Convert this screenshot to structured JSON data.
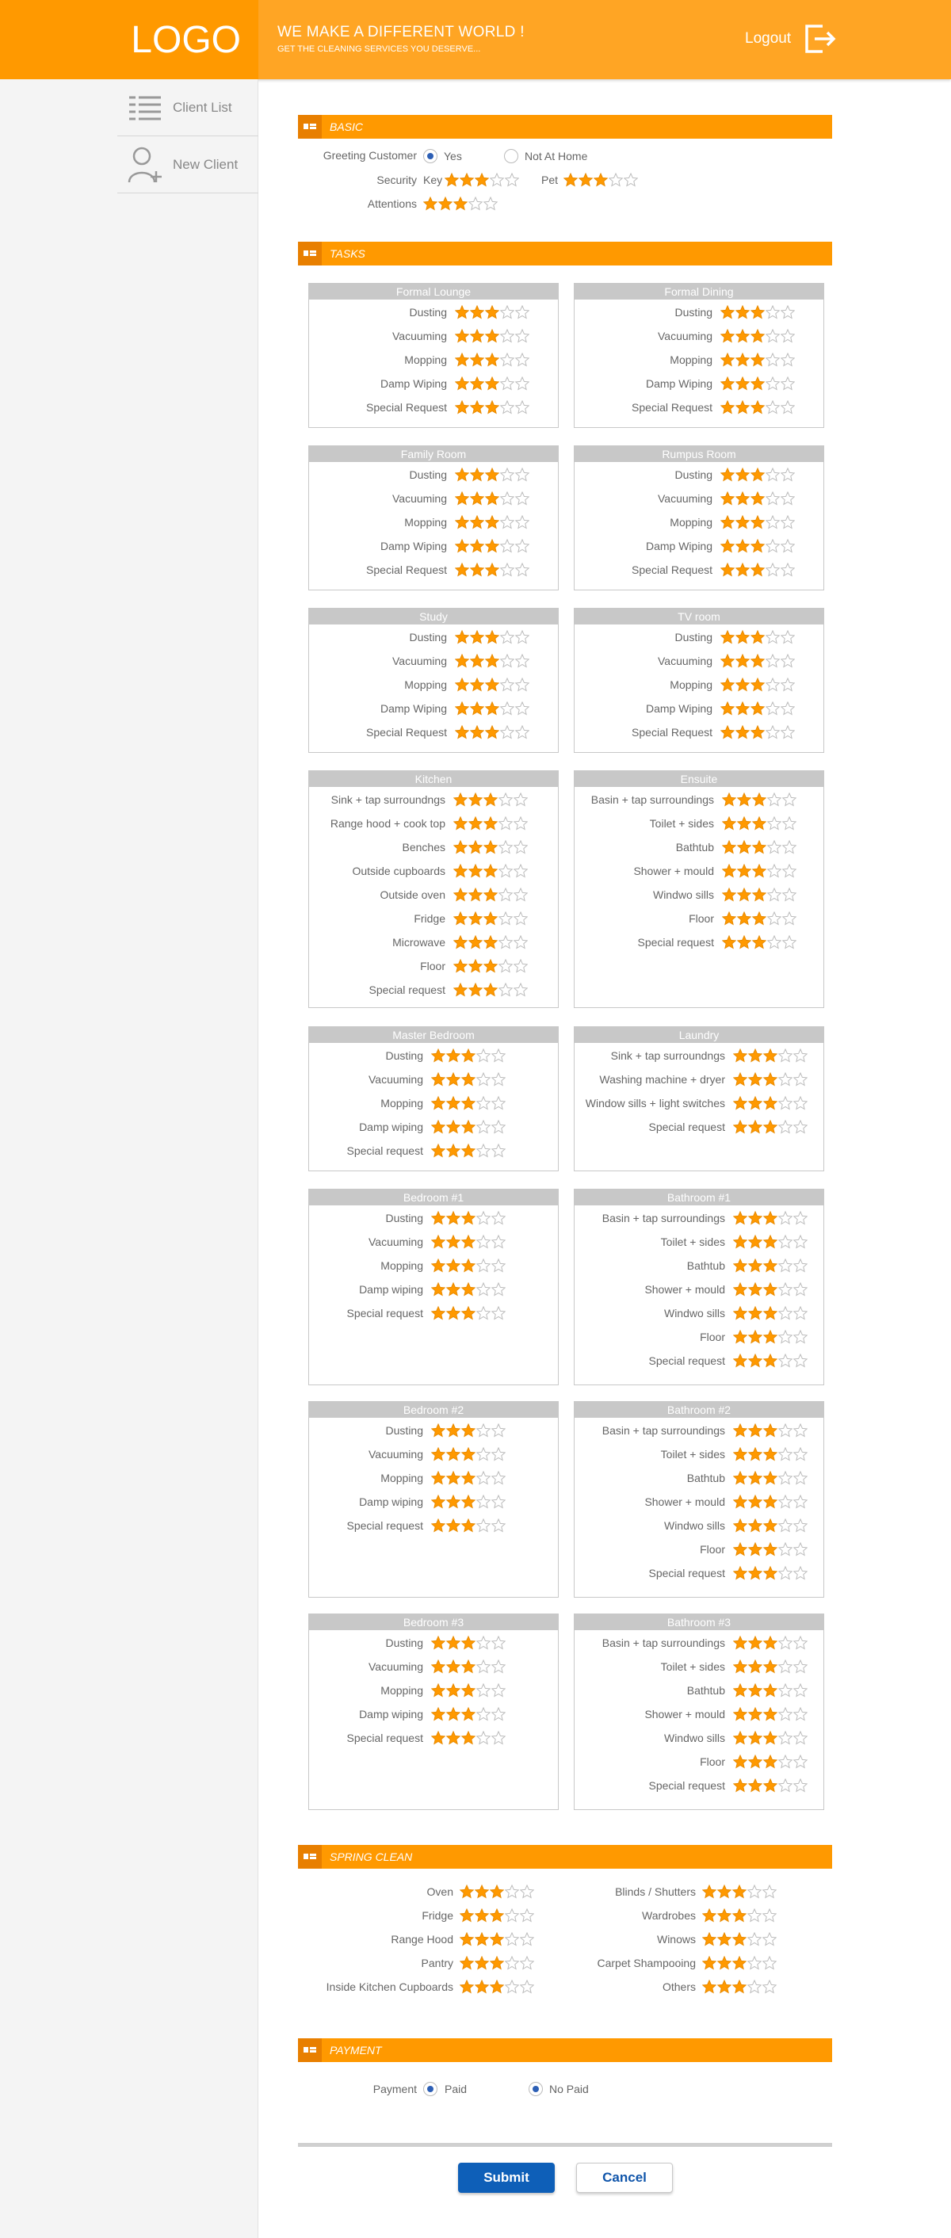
{
  "header": {
    "logo": "LOGO",
    "slogan": "WE MAKE A DIFFERENT WORLD !",
    "tagline": "GET THE CLEANING SERVICES YOU DESERVE...",
    "logout_label": "Logout"
  },
  "sidebar": {
    "items": [
      {
        "label": "Client List",
        "icon": "list-icon"
      },
      {
        "label": "New Client",
        "icon": "add-user-icon"
      }
    ]
  },
  "colors": {
    "accent": "#ff9900",
    "header_bg": "#ffa524",
    "star_filled": "#ff9900",
    "star_empty": "#bbbbbb",
    "room_header": "#c8c8c8",
    "primary_button": "#0e5fb8"
  },
  "basic": {
    "title": "BASIC",
    "greeting_label": "Greeting Customer",
    "greeting_options": [
      "Yes",
      "Not At Home"
    ],
    "greeting_selected": "Yes",
    "security_label": "Security",
    "key_label": "Key",
    "key_rating": 3,
    "pet_label": "Pet",
    "pet_rating": 3,
    "attentions_label": "Attentions",
    "attentions_rating": 3
  },
  "tasks": {
    "title": "TASKS",
    "rooms": [
      {
        "name": "Formal Lounge",
        "items": [
          {
            "label": "Dusting",
            "rating": 3
          },
          {
            "label": "Vacuuming",
            "rating": 3
          },
          {
            "label": "Mopping",
            "rating": 3
          },
          {
            "label": "Damp Wiping",
            "rating": 3
          },
          {
            "label": "Special Request",
            "rating": 3
          }
        ]
      },
      {
        "name": "Formal Dining",
        "items": [
          {
            "label": "Dusting",
            "rating": 3
          },
          {
            "label": "Vacuuming",
            "rating": 3
          },
          {
            "label": "Mopping",
            "rating": 3
          },
          {
            "label": "Damp Wiping",
            "rating": 3
          },
          {
            "label": "Special Request",
            "rating": 3
          }
        ]
      },
      {
        "name": "Family Room",
        "items": [
          {
            "label": "Dusting",
            "rating": 3
          },
          {
            "label": "Vacuuming",
            "rating": 3
          },
          {
            "label": "Mopping",
            "rating": 3
          },
          {
            "label": "Damp Wiping",
            "rating": 3
          },
          {
            "label": "Special Request",
            "rating": 3
          }
        ]
      },
      {
        "name": "Rumpus Room",
        "items": [
          {
            "label": "Dusting",
            "rating": 3
          },
          {
            "label": "Vacuuming",
            "rating": 3
          },
          {
            "label": "Mopping",
            "rating": 3
          },
          {
            "label": "Damp Wiping",
            "rating": 3
          },
          {
            "label": "Special Request",
            "rating": 3
          }
        ]
      },
      {
        "name": "Study",
        "items": [
          {
            "label": "Dusting",
            "rating": 3
          },
          {
            "label": "Vacuuming",
            "rating": 3
          },
          {
            "label": "Mopping",
            "rating": 3
          },
          {
            "label": "Damp Wiping",
            "rating": 3
          },
          {
            "label": "Special Request",
            "rating": 3
          }
        ]
      },
      {
        "name": "TV room",
        "items": [
          {
            "label": "Dusting",
            "rating": 3
          },
          {
            "label": "Vacuuming",
            "rating": 3
          },
          {
            "label": "Mopping",
            "rating": 3
          },
          {
            "label": "Damp Wiping",
            "rating": 3
          },
          {
            "label": "Special Request",
            "rating": 3
          }
        ]
      },
      {
        "name": "Kitchen",
        "items": [
          {
            "label": "Sink + tap surroundngs",
            "rating": 3
          },
          {
            "label": "Range hood + cook top",
            "rating": 3
          },
          {
            "label": "Benches",
            "rating": 3
          },
          {
            "label": "Outside cupboards",
            "rating": 3
          },
          {
            "label": "Outside oven",
            "rating": 3
          },
          {
            "label": "Fridge",
            "rating": 3
          },
          {
            "label": "Microwave",
            "rating": 3
          },
          {
            "label": "Floor",
            "rating": 3
          },
          {
            "label": "Special request",
            "rating": 3
          }
        ]
      },
      {
        "name": "Ensuite",
        "items": [
          {
            "label": "Basin + tap surroundings",
            "rating": 3
          },
          {
            "label": "Toilet + sides",
            "rating": 3
          },
          {
            "label": "Bathtub",
            "rating": 3
          },
          {
            "label": "Shower + mould",
            "rating": 3
          },
          {
            "label": "Windwo sills",
            "rating": 3
          },
          {
            "label": "Floor",
            "rating": 3
          },
          {
            "label": "Special request",
            "rating": 3
          }
        ]
      },
      {
        "name": "Master Bedroom",
        "items": [
          {
            "label": "Dusting",
            "rating": 3
          },
          {
            "label": "Vacuuming",
            "rating": 3
          },
          {
            "label": "Mopping",
            "rating": 3
          },
          {
            "label": "Damp wiping",
            "rating": 3
          },
          {
            "label": "Special request",
            "rating": 3
          }
        ]
      },
      {
        "name": "Laundry",
        "items": [
          {
            "label": "Sink + tap surroundngs",
            "rating": 3
          },
          {
            "label": "Washing machine + dryer",
            "rating": 3
          },
          {
            "label": "Window sills + light switches",
            "rating": 3
          },
          {
            "label": "Special request",
            "rating": 3
          }
        ]
      },
      {
        "name": "Bedroom #1",
        "items": [
          {
            "label": "Dusting",
            "rating": 3
          },
          {
            "label": "Vacuuming",
            "rating": 3
          },
          {
            "label": "Mopping",
            "rating": 3
          },
          {
            "label": "Damp wiping",
            "rating": 3
          },
          {
            "label": "Special request",
            "rating": 3
          }
        ]
      },
      {
        "name": "Bathroom #1",
        "items": [
          {
            "label": "Basin + tap surroundings",
            "rating": 3
          },
          {
            "label": "Toilet + sides",
            "rating": 3
          },
          {
            "label": "Bathtub",
            "rating": 3
          },
          {
            "label": "Shower + mould",
            "rating": 3
          },
          {
            "label": "Windwo sills",
            "rating": 3
          },
          {
            "label": "Floor",
            "rating": 3
          },
          {
            "label": "Special request",
            "rating": 3
          }
        ]
      },
      {
        "name": "Bedroom #2",
        "items": [
          {
            "label": "Dusting",
            "rating": 3
          },
          {
            "label": "Vacuuming",
            "rating": 3
          },
          {
            "label": "Mopping",
            "rating": 3
          },
          {
            "label": "Damp wiping",
            "rating": 3
          },
          {
            "label": "Special request",
            "rating": 3
          }
        ]
      },
      {
        "name": "Bathroom #2",
        "items": [
          {
            "label": "Basin + tap surroundings",
            "rating": 3
          },
          {
            "label": "Toilet + sides",
            "rating": 3
          },
          {
            "label": "Bathtub",
            "rating": 3
          },
          {
            "label": "Shower + mould",
            "rating": 3
          },
          {
            "label": "Windwo sills",
            "rating": 3
          },
          {
            "label": "Floor",
            "rating": 3
          },
          {
            "label": "Special request",
            "rating": 3
          }
        ]
      },
      {
        "name": "Bedroom #3",
        "items": [
          {
            "label": "Dusting",
            "rating": 3
          },
          {
            "label": "Vacuuming",
            "rating": 3
          },
          {
            "label": "Mopping",
            "rating": 3
          },
          {
            "label": "Damp wiping",
            "rating": 3
          },
          {
            "label": "Special request",
            "rating": 3
          }
        ]
      },
      {
        "name": "Bathroom #3",
        "items": [
          {
            "label": "Basin + tap surroundings",
            "rating": 3
          },
          {
            "label": "Toilet + sides",
            "rating": 3
          },
          {
            "label": "Bathtub",
            "rating": 3
          },
          {
            "label": "Shower + mould",
            "rating": 3
          },
          {
            "label": "Windwo sills",
            "rating": 3
          },
          {
            "label": "Floor",
            "rating": 3
          },
          {
            "label": "Special request",
            "rating": 3
          }
        ]
      }
    ]
  },
  "spring_clean": {
    "title": "SPRING CLEAN",
    "left": [
      {
        "label": "Oven",
        "rating": 3
      },
      {
        "label": "Fridge",
        "rating": 3
      },
      {
        "label": "Range Hood",
        "rating": 3
      },
      {
        "label": "Pantry",
        "rating": 3
      },
      {
        "label": "Inside Kitchen Cupboards",
        "rating": 3
      }
    ],
    "right": [
      {
        "label": "Blinds / Shutters",
        "rating": 3
      },
      {
        "label": "Wardrobes",
        "rating": 3
      },
      {
        "label": "Winows",
        "rating": 3
      },
      {
        "label": "Carpet Shampooing",
        "rating": 3
      },
      {
        "label": "Others",
        "rating": 3
      }
    ]
  },
  "payment": {
    "title": "PAYMENT",
    "label": "Payment",
    "options": [
      "Paid",
      "No Paid"
    ],
    "selected": [
      "Paid",
      "No Paid"
    ]
  },
  "actions": {
    "submit": "Submit",
    "cancel": "Cancel"
  }
}
